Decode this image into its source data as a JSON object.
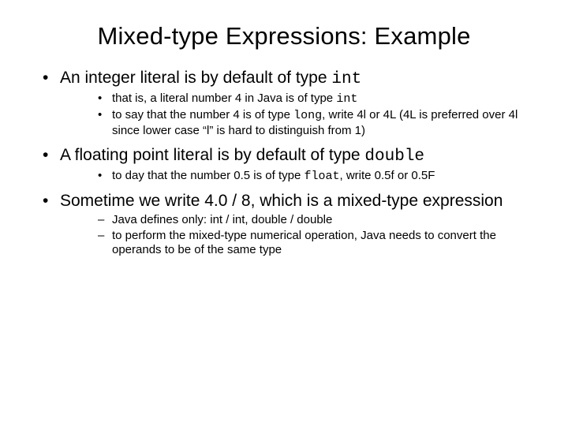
{
  "title": "Mixed-type Expressions: Example",
  "bullets": [
    {
      "text_pre": "An integer literal is by default of type ",
      "code": "int",
      "text_post": "",
      "sub_style": "bullet",
      "sub": [
        {
          "pre": "that is, a literal number 4 in Java is of type ",
          "code": "int",
          "post": ""
        },
        {
          "pre": "to say that the number 4 is of type ",
          "code": "long",
          "post": ", write 4l or 4L (4L is preferred over 4l since lower case “l” is hard to distinguish from 1)"
        }
      ]
    },
    {
      "text_pre": "A floating point literal is by default of type ",
      "code": "double",
      "text_post": "",
      "sub_style": "bullet",
      "sub": [
        {
          "pre": "to day that the number 0.5 is of type ",
          "code": "float",
          "post": ", write 0.5f or 0.5F"
        }
      ]
    },
    {
      "text_pre": "Sometime we write 4.0 / 8, which is a mixed-type expression",
      "code": "",
      "text_post": "",
      "sub_style": "dash",
      "sub": [
        {
          "pre": "Java defines only: int / int, double / double",
          "code": "",
          "post": ""
        },
        {
          "pre": "to perform the mixed-type numerical operation, Java needs to convert the operands to be of the same type",
          "code": "",
          "post": ""
        }
      ]
    }
  ]
}
